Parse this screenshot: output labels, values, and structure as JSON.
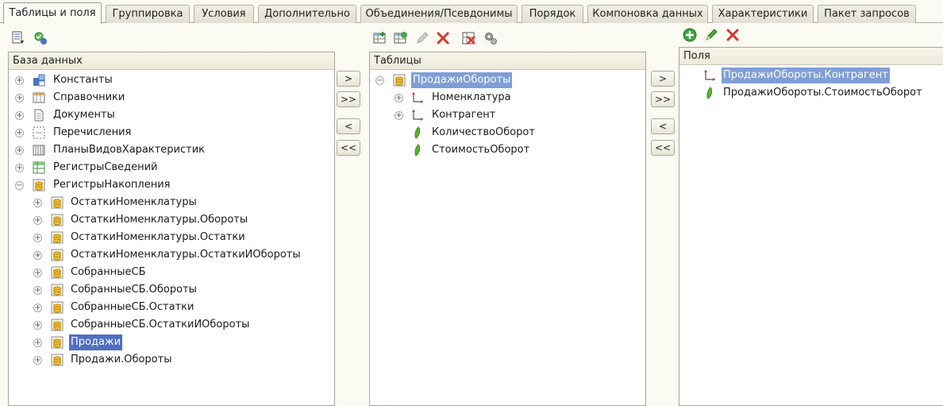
{
  "tabs": [
    {
      "label": "Таблицы и поля",
      "active": true
    },
    {
      "label": "Группировка"
    },
    {
      "label": "Условия"
    },
    {
      "label": "Дополнительно"
    },
    {
      "label": "Объединения/Псевдонимы"
    },
    {
      "label": "Порядок"
    },
    {
      "label": "Компоновка данных"
    },
    {
      "label": "Характеристики"
    },
    {
      "label": "Пакет запросов"
    }
  ],
  "database_panel": {
    "title": "База данных",
    "items": [
      {
        "label": "Константы",
        "icon": "constants-icon"
      },
      {
        "label": "Справочники",
        "icon": "catalogs-icon"
      },
      {
        "label": "Документы",
        "icon": "documents-icon"
      },
      {
        "label": "Перечисления",
        "icon": "enums-icon"
      },
      {
        "label": "ПланыВидовХарактеристик",
        "icon": "characteristics-icon"
      },
      {
        "label": "РегистрыСведений",
        "icon": "info-registers-icon"
      },
      {
        "label": "РегистрыНакопления",
        "icon": "accumulation-registers-icon"
      },
      {
        "label": "ОстаткиНоменклатуры"
      },
      {
        "label": "ОстаткиНоменклатуры.Обороты"
      },
      {
        "label": "ОстаткиНоменклатуры.Остатки"
      },
      {
        "label": "ОстаткиНоменклатуры.ОстаткиИОбороты"
      },
      {
        "label": "СобранныеСБ"
      },
      {
        "label": "СобранныеСБ.Обороты"
      },
      {
        "label": "СобранныеСБ.Остатки"
      },
      {
        "label": "СобранныеСБ.ОстаткиИОбороты"
      },
      {
        "label": "Продажи",
        "selected": true
      },
      {
        "label": "Продажи.Обороты"
      }
    ]
  },
  "tables_panel": {
    "title": "Таблицы",
    "items": [
      {
        "label": "ПродажиОбороты"
      },
      {
        "label": "Номенклатура"
      },
      {
        "label": "Контрагент"
      },
      {
        "label": "КоличествоОборот"
      },
      {
        "label": "СтоимостьОборот"
      }
    ]
  },
  "fields_panel": {
    "title": "Поля",
    "items": [
      {
        "label": "ПродажиОбороты.Контрагент"
      },
      {
        "label": "ПродажиОбороты.СтоимостьОборот"
      }
    ]
  },
  "transfer_buttons": {
    "add": ">",
    "add_all": ">>",
    "remove": "<",
    "remove_all": "<<"
  },
  "colors": {
    "selection": "#4f6ec2",
    "background": "#fbfaf3"
  }
}
